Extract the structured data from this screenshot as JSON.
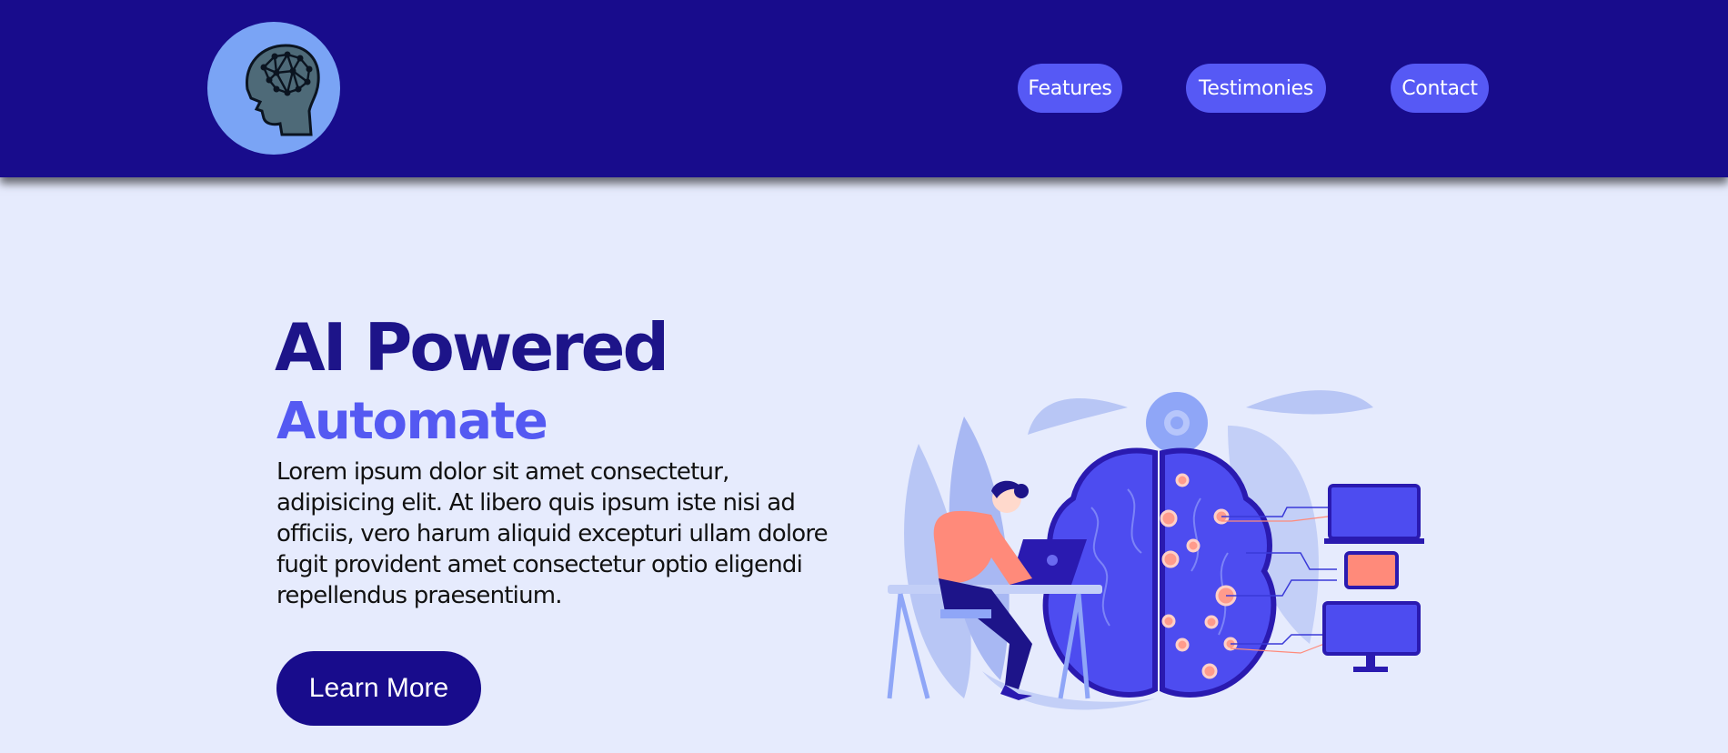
{
  "header": {
    "logo_icon": "ai-brain-head-icon",
    "nav": [
      {
        "label": "Features"
      },
      {
        "label": "Testimonies"
      },
      {
        "label": "Contact"
      }
    ]
  },
  "hero": {
    "title": "AI Powered",
    "subtitle": "Automate",
    "body": "Lorem ipsum dolor sit amet consectetur, adipisicing elit. At libero quis ipsum iste nisi ad officiis, vero harum aliquid excepturi ullam dolore fugit provident amet consectetur optio eligendi repellendus praesentium.",
    "cta_label": "Learn More",
    "illustration_icon": "ai-brain-illustration"
  },
  "colors": {
    "header_bg": "#180c8c",
    "page_bg": "#e6ebfd",
    "accent": "#5659f5",
    "title": "#1d1489",
    "logo_bg": "#7aa4f5"
  }
}
